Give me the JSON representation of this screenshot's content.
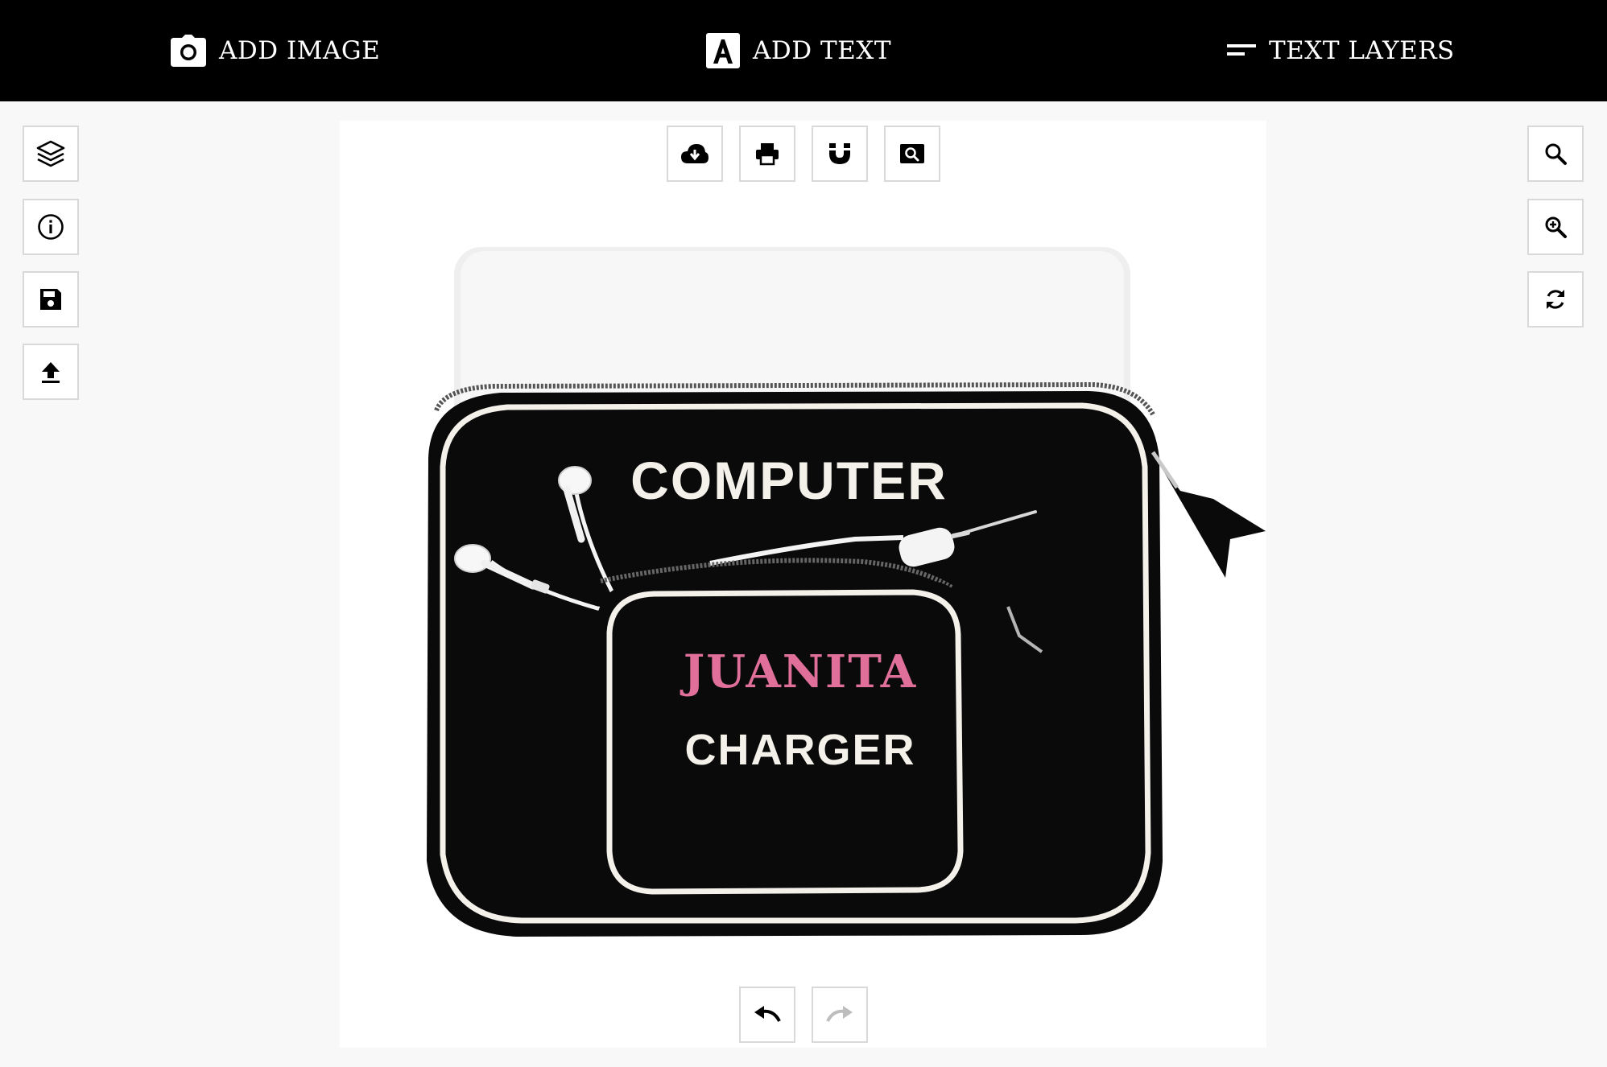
{
  "topbar": {
    "add_image": {
      "label": "ADD IMAGE",
      "icon": "camera-icon"
    },
    "add_text": {
      "label": "ADD TEXT",
      "icon": "text-a-icon"
    },
    "text_layers": {
      "label": "TEXT LAYERS",
      "icon": "layers-lines-icon"
    }
  },
  "left_tools": [
    {
      "icon": "layers-icon"
    },
    {
      "icon": "info-icon"
    },
    {
      "icon": "save-icon"
    },
    {
      "icon": "upload-icon"
    }
  ],
  "right_tools": [
    {
      "icon": "search-icon"
    },
    {
      "icon": "zoom-in-icon"
    },
    {
      "icon": "refresh-icon"
    }
  ],
  "canvas_toolbar": [
    {
      "icon": "cloud-download-icon"
    },
    {
      "icon": "print-icon"
    },
    {
      "icon": "magnet-icon"
    },
    {
      "icon": "preview-search-icon"
    }
  ],
  "history": [
    {
      "icon": "undo-icon",
      "enabled": true
    },
    {
      "icon": "redo-icon",
      "enabled": false
    }
  ],
  "design": {
    "line1": "COMPUTER",
    "name": "JUANITA",
    "line2": "CHARGER",
    "name_color": "#e0709a",
    "text_color": "#f4f1ea",
    "sleeve_color": "#0a0a0a",
    "trim_color": "#f4f1ea"
  }
}
